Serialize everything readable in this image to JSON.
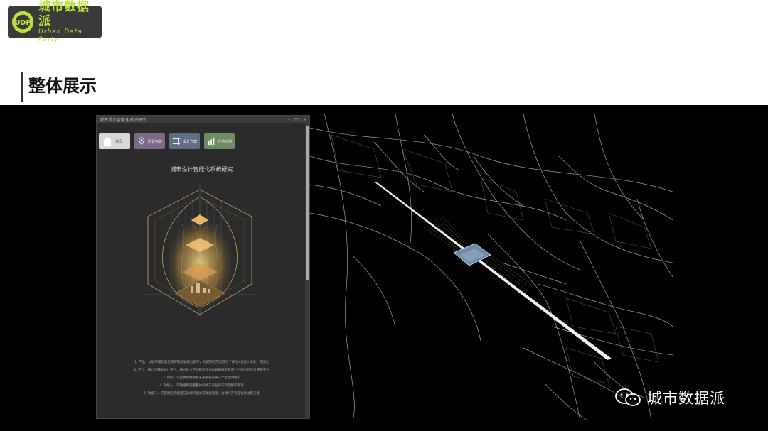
{
  "brand": {
    "name_cn": "城市数据派",
    "name_en": "Urban Data Party",
    "accent": "#b9e23a"
  },
  "slide": {
    "title": "整体展示"
  },
  "app_window": {
    "title": "城市设计智能化系统研究",
    "controls": [
      "–",
      "□",
      "×"
    ],
    "nav": [
      {
        "label": "首页",
        "icon": "home-icon"
      },
      {
        "label": "愿景构建",
        "icon": "map-pin-icon"
      },
      {
        "label": "设计方案",
        "icon": "grid-icon"
      },
      {
        "label": "评估检测",
        "icon": "bar-chart-icon"
      }
    ],
    "heading": "城市设计智能化系统研究",
    "notes": [
      "1. 产品：以城市规划理论和可持续发展为指导，对城市的方案进行「评估+优化+优化」可视化",
      "2. 定位：核心为辅助设计平台，通过建立空间模型和多类数据模型形成一个综合的设计决策平台",
      "3. 目的：以此协助规划和未来发展的每一个土地的组织",
      "4. 功能一：可快速和完整整体的关于专业知识和理解和表现",
      "5. 功能二：可提供应用模型与策划的相关实数据展示，为领导方专业设计过程决策"
    ]
  },
  "watermark": {
    "text": "城市数据派",
    "icon": "wechat-icon"
  }
}
